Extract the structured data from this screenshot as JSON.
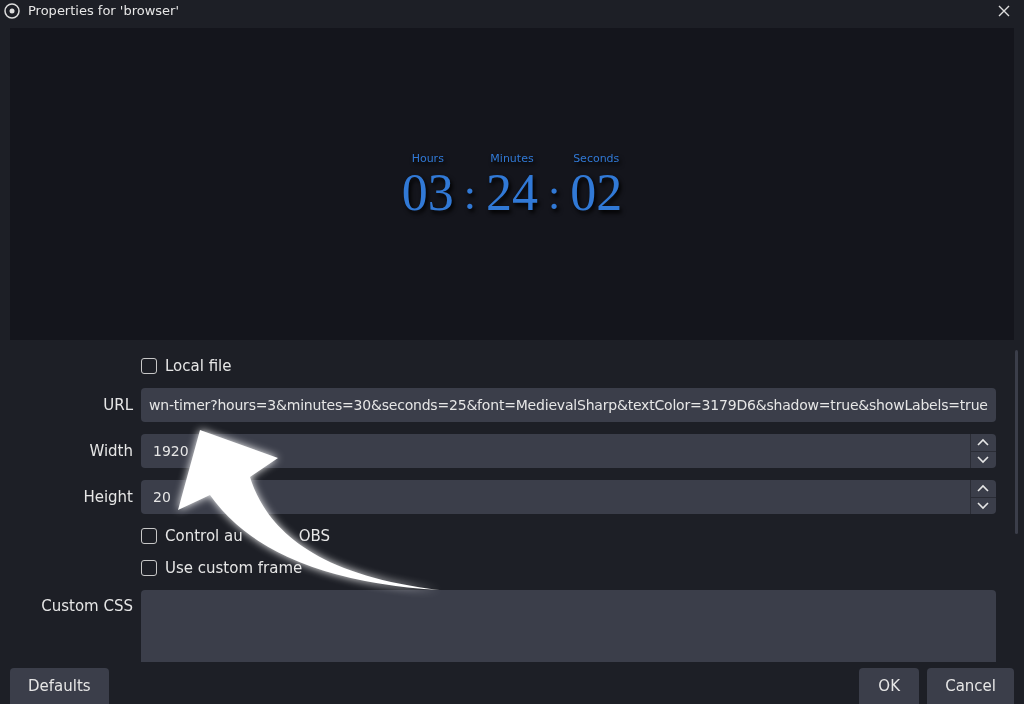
{
  "window": {
    "title": "Properties for 'browser'"
  },
  "preview": {
    "units": [
      {
        "label": "Hours",
        "value": "03"
      },
      {
        "label": "Minutes",
        "value": "24"
      },
      {
        "label": "Seconds",
        "value": "02"
      }
    ],
    "separators": [
      ":",
      ":"
    ]
  },
  "form": [
    {
      "kind": "checkbox",
      "label": "Local file",
      "checked": false
    },
    {
      "kind": "text",
      "label": "URL",
      "value": "wn-timer?hours=3&minutes=30&seconds=25&font=MedievalSharp&textColor=3179D6&shadow=true&showLabels=true"
    },
    {
      "kind": "spin",
      "label": "Width",
      "value": "1920"
    },
    {
      "kind": "spin",
      "label": "Height",
      "value": "20"
    },
    {
      "kind": "checkbox",
      "label": "Control au",
      "label_tail": "OBS",
      "checked": false
    },
    {
      "kind": "checkbox",
      "label": "Use custom frame",
      "checked": false
    },
    {
      "kind": "textarea",
      "label": "Custom CSS"
    }
  ],
  "buttons_left": [
    "Defaults"
  ],
  "buttons_right": [
    "OK",
    "Cancel"
  ]
}
